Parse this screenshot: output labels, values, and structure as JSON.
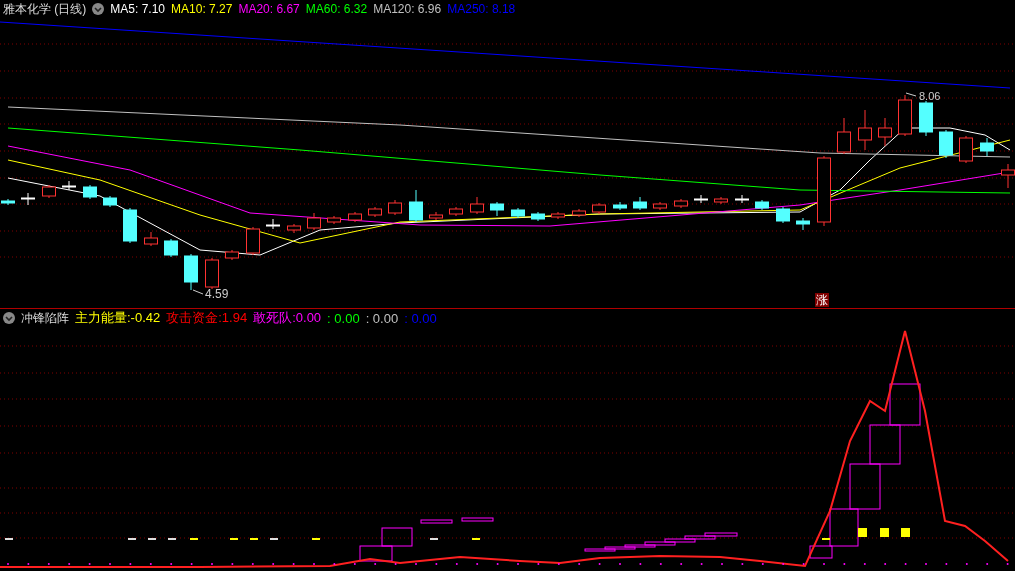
{
  "price_panel": {
    "title": "雅本化学 (日线)",
    "moving_averages": [
      {
        "label": "MA5:",
        "value": "7.10",
        "color": "#ffffff"
      },
      {
        "label": "MA10:",
        "value": "7.27",
        "color": "#ffff00"
      },
      {
        "label": "MA20:",
        "value": "6.67",
        "color": "#ff00ff"
      },
      {
        "label": "MA60:",
        "value": "6.32",
        "color": "#00ff00"
      },
      {
        "label": "MA120:",
        "value": "6.96",
        "color": "#c0c0c0"
      },
      {
        "label": "MA250:",
        "value": "8.18",
        "color": "#0000ff"
      }
    ],
    "high_label": "8.06",
    "low_label": "4.59",
    "signal_badge": "涨"
  },
  "indicator_panel": {
    "title": "冲锋陷阵",
    "readings": [
      {
        "label": "主力能量:",
        "value": "-0.42",
        "color": "#ffff00"
      },
      {
        "label": "攻击资金:",
        "value": "1.94",
        "color": "#ff0000"
      },
      {
        "label": "敢死队:",
        "value": "0.00",
        "color": "#ff00ff"
      },
      {
        "value": ": 0.00",
        "color": "#00ff00"
      },
      {
        "value": ": 0.00",
        "color": "#c0c0c0"
      },
      {
        "value": ": 0.00",
        "color": "#0000ff"
      }
    ]
  }
}
